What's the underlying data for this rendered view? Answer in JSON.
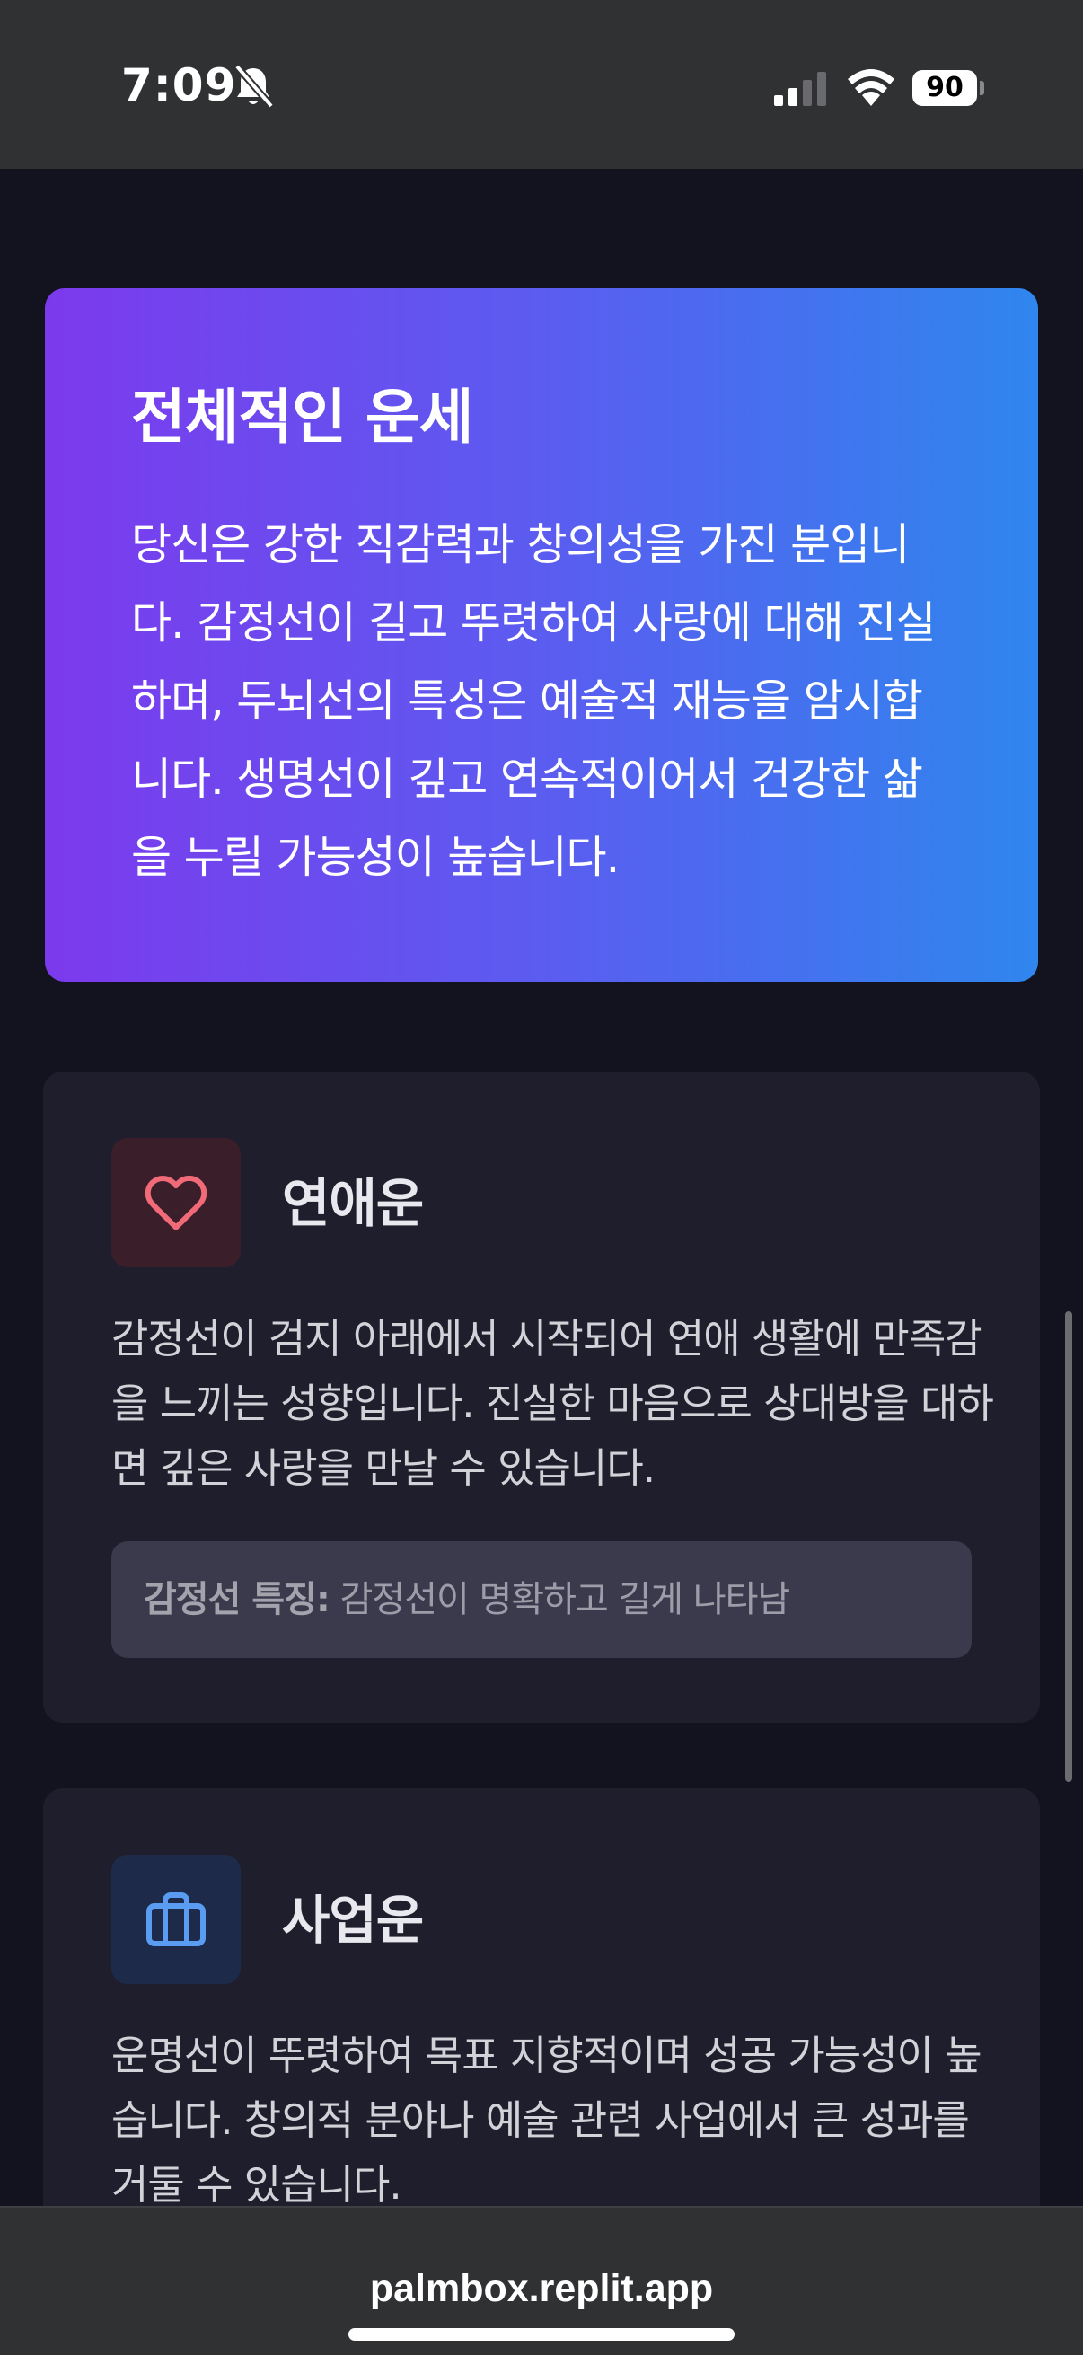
{
  "status_bar": {
    "time": "7:09",
    "battery_level": "90",
    "silent_mode": true,
    "icons": [
      "bell-slash-icon",
      "cellular-signal-icon",
      "wifi-icon",
      "battery-icon"
    ]
  },
  "overall": {
    "title": "전체적인 운세",
    "text": "당신은 강한 직감력과 창의성을 가진 분입니다. 감정선이 길고 뚜렷하여 사랑에 대해 진실하며, 두뇌선의 특성은 예술적 재능을 암시합니다. 생명선이 깊고 연속적이어서 건강한 삶을 누릴 가능성이 높습니다.",
    "gradient_start": "#7c3aed",
    "gradient_end": "#2f86ee"
  },
  "love": {
    "icon": "heart-icon",
    "icon_color": "#f06a78",
    "icon_bg": "#3a1f2a",
    "title": "연애운",
    "text": "감정선이 검지 아래에서 시작되어 연애 생활에 만족감을 느끼는 성향입니다. 진실한 마음으로 상대방을 대하면 깊은 사랑을 만날 수 있습니다.",
    "feature_label": "감정선 특징:",
    "feature_value": " 감정선이 명확하고 길게 나타남"
  },
  "business": {
    "icon": "briefcase-icon",
    "icon_color": "#5a9cf2",
    "icon_bg": "#1d2a4a",
    "title": "사업운",
    "text": "운명선이 뚜렷하여 목표 지향적이며 성공 가능성이 높습니다. 창의적 분야나 예술 관련 사업에서 큰 성과를 거둘 수 있습니다."
  },
  "browser": {
    "url": "palmbox.replit.app"
  }
}
